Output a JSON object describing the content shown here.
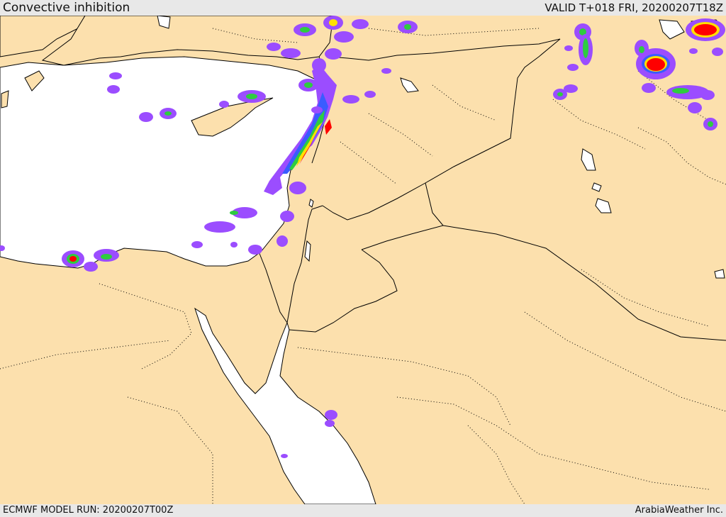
{
  "header": {
    "title": "Convective inhibition",
    "valid": "VALID T+018 FRI, 20200207T18Z"
  },
  "footer": {
    "model_run": "ECMWF MODEL RUN: 20200207T00Z",
    "credit": "ArabiaWeather Inc."
  },
  "colors": {
    "land": "#fce0ad",
    "water": "#ffffff",
    "scale_purple": "#9b4dff",
    "scale_blue": "#3a5cff",
    "scale_green": "#2ecc40",
    "scale_yellow": "#ffe000",
    "scale_red": "#ff0000"
  }
}
